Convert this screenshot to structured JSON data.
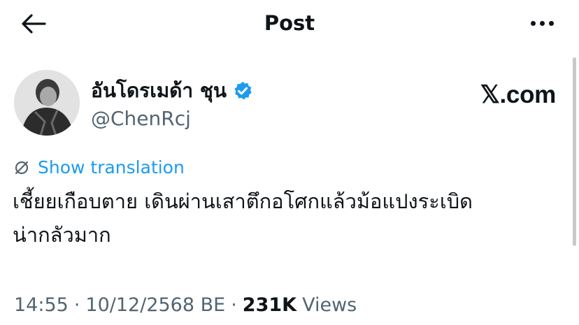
{
  "header": {
    "title": "Post",
    "back_icon": "back-arrow-icon",
    "more_icon": "more-options-icon"
  },
  "author": {
    "display_name": "อันโดรเมด้า ชุน",
    "handle": "@ChenRcj",
    "verified": true,
    "verified_color": "#1d9bf0"
  },
  "brand": {
    "label": "𝕏.com"
  },
  "post": {
    "translation_label": "Show translation",
    "text_line1": "เชี้ยยเกือบตาย เดินผ่านเสาตึกอโศกแล้วม้อแปงระเบิด",
    "text_line2": "น่ากลัวมาก"
  },
  "meta": {
    "time": "14:55",
    "separator": "·",
    "date": "10/12/2568 BE",
    "views_count": "231K",
    "views_label": "Views"
  },
  "colors": {
    "accent": "#1d9bf0",
    "muted_text": "#536471",
    "primary_text": "#0f1419"
  }
}
